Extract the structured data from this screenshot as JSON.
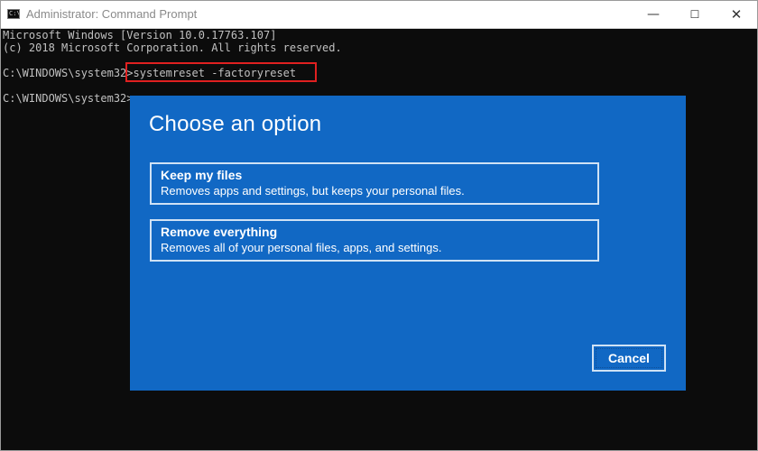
{
  "window": {
    "title": "Administrator: Command Prompt",
    "icon_text": "C:\\",
    "controls": {
      "minimize": "—",
      "maximize": "☐",
      "close": "✕"
    }
  },
  "console": {
    "lines": [
      "Microsoft Windows [Version 10.0.17763.107]",
      "(c) 2018 Microsoft Corporation. All rights reserved."
    ],
    "prompt1": "C:\\WINDOWS\\system32>",
    "command": "systemreset -factoryreset",
    "prompt2": "C:\\WINDOWS\\system32>"
  },
  "dialog": {
    "title": "Choose an option",
    "options": [
      {
        "title": "Keep my files",
        "description": "Removes apps and settings, but keeps your personal files."
      },
      {
        "title": "Remove everything",
        "description": "Removes all of your personal files, apps, and settings."
      }
    ],
    "cancel_label": "Cancel"
  },
  "colors": {
    "console_bg": "#0c0c0c",
    "console_text": "#c0c0c0",
    "dialog_bg": "#1168c4",
    "highlight": "#e02020"
  }
}
